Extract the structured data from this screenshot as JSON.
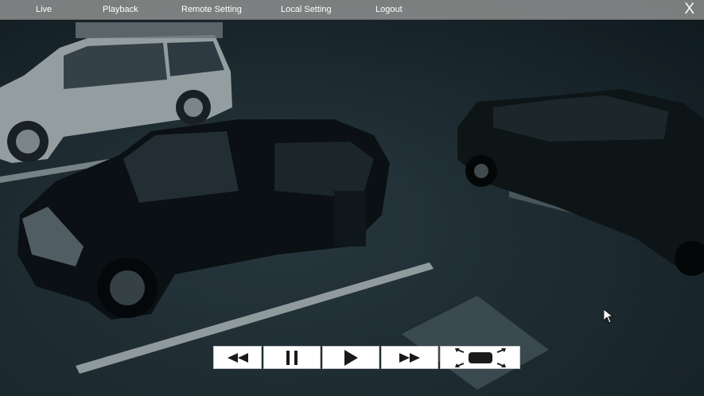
{
  "nav": {
    "live": "Live",
    "playback": "Playback",
    "remote_setting": "Remote Setting",
    "local_setting": "Local Setting",
    "logout": "Logout"
  },
  "close_label": "X",
  "controls": {
    "rewind_icon": "rewind-icon",
    "pause_icon": "pause-icon",
    "play_icon": "play-icon",
    "forward_icon": "fast-forward-icon",
    "fullscreen_icon": "fullscreen-icon"
  },
  "colors": {
    "topbar": "#8c8c8c",
    "button_bg": "#ffffff",
    "icon": "#1a1a1a",
    "video_tint": "#0d1a20"
  }
}
